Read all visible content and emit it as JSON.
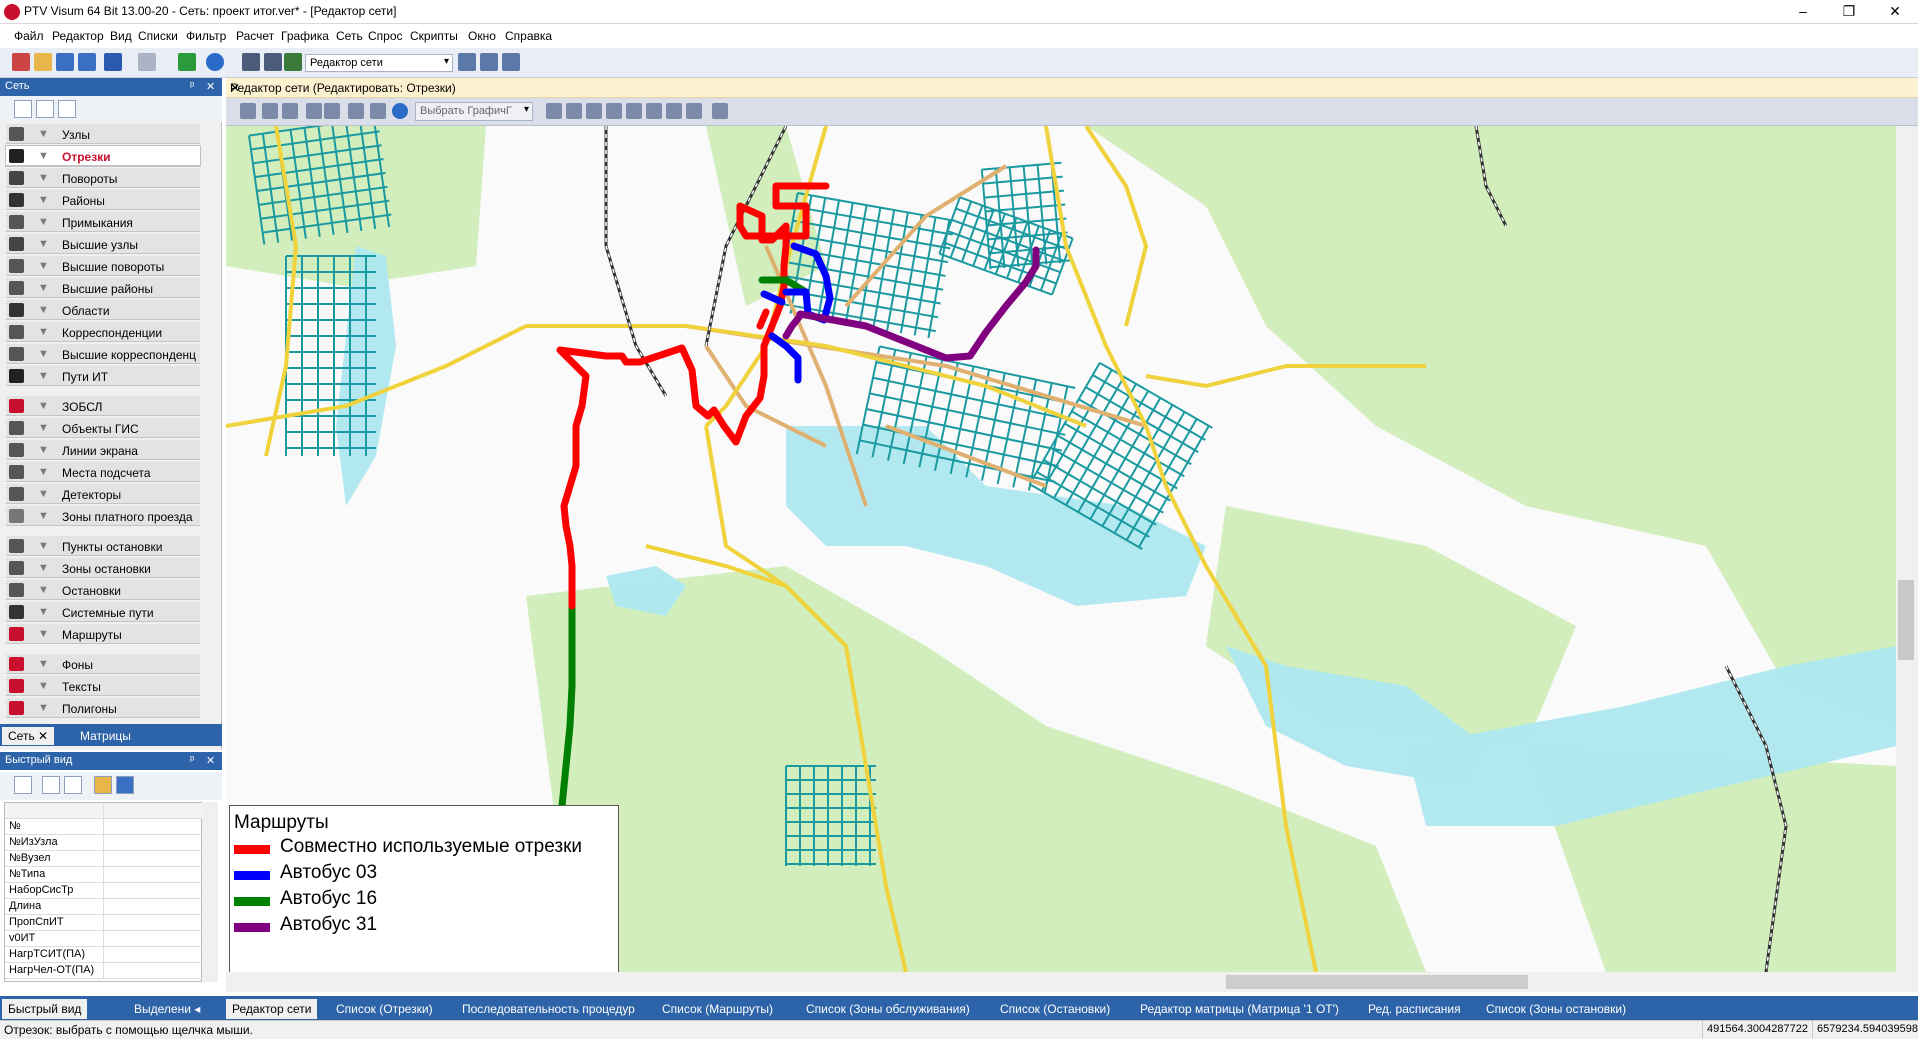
{
  "window": {
    "title": "PTV Visum 64 Bit 13.00-20 - Сеть: проект итог.ver* - [Редактор сети]",
    "controls": [
      "–",
      "❐",
      "✕"
    ]
  },
  "menu": [
    "Файл",
    "Редактор",
    "Вид",
    "Списки",
    "Фильтр",
    "Расчет",
    "Графика",
    "Сеть",
    "Спрос",
    "Скрипты",
    "Окно",
    "Справка"
  ],
  "toolbar": {
    "editor_mode": "Редактор сети"
  },
  "left_panel": {
    "title": "Сеть",
    "pin": "ᵖ",
    "close": "✕",
    "items": [
      {
        "label": "Узлы"
      },
      {
        "label": "Отрезки",
        "selected": true
      },
      {
        "label": "Повороты"
      },
      {
        "label": "Районы"
      },
      {
        "label": "Примыкания"
      },
      {
        "label": "Высшие узлы"
      },
      {
        "label": "Высшие повороты"
      },
      {
        "label": "Высшие районы"
      },
      {
        "label": "Области"
      },
      {
        "label": "Корреспонденции"
      },
      {
        "label": "Высшие корреспонденц"
      },
      {
        "label": "Пути ИТ"
      },
      {
        "label": "ЗОБСЛ"
      },
      {
        "label": "Объекты ГИС"
      },
      {
        "label": "Линии экрана"
      },
      {
        "label": "Места подсчета"
      },
      {
        "label": "Детекторы"
      },
      {
        "label": "Зоны платного проезда"
      },
      {
        "label": "Пункты остановки"
      },
      {
        "label": "Зоны остановки"
      },
      {
        "label": "Остановки"
      },
      {
        "label": "Системные пути"
      },
      {
        "label": "Маршруты"
      },
      {
        "label": "Фоны"
      },
      {
        "label": "Тексты"
      },
      {
        "label": "Полигоны"
      }
    ],
    "tabs": {
      "net": "Сеть",
      "net_close": "✕",
      "matrices": "Матрицы"
    }
  },
  "quick_view": {
    "title": "Быстрый вид",
    "rows": [
      "№",
      "№ИзУзла",
      "№Вузел",
      "№Типа",
      "НаборСисТр",
      "Длина",
      "ПропСпИТ",
      "v0ИТ",
      "НагрТСИТ(ПА)",
      "НагрЧел-ОТ(ПА)"
    ]
  },
  "document": {
    "title": "Редактор сети (Редактировать: Отрезки)",
    "close": "✕",
    "graphic_select": "Выбрать ГрафичГ"
  },
  "legend": {
    "title": "Маршруты",
    "items": [
      {
        "label": "Совместно используемые отрезки",
        "color": "#ff0000"
      },
      {
        "label": "Автобус 03",
        "color": "#0000ff"
      },
      {
        "label": "Автобус 16",
        "color": "#008000"
      },
      {
        "label": "Автобус 31",
        "color": "#800080"
      }
    ]
  },
  "map_colors": {
    "water": "#aee8ef",
    "green": "#c9ebb0",
    "street": "#1a9aa0",
    "main_road": "#f0d23c",
    "arterial": "#e0b070",
    "background": "#fafafa"
  },
  "bottom_tabs": [
    {
      "label": "Быстрый вид",
      "active": true
    },
    {
      "label": "Выделени ◂"
    },
    {
      "label": "Редактор сети",
      "active": true
    },
    {
      "label": "Список (Отрезки)"
    },
    {
      "label": "Последовательность процедур"
    },
    {
      "label": "Список (Маршруты)"
    },
    {
      "label": "Список (Зоны обслуживания)"
    },
    {
      "label": "Список (Остановки)"
    },
    {
      "label": "Редактор матрицы (Матрица '1 ОТ')"
    },
    {
      "label": "Ред. расписания"
    },
    {
      "label": "Список (Зоны остановки)"
    }
  ],
  "status": {
    "text": "Отрезок: выбрать с помощью щелчка мыши.",
    "coord_x": "491564.3004287722",
    "coord_y": "6579234.5940395985"
  }
}
